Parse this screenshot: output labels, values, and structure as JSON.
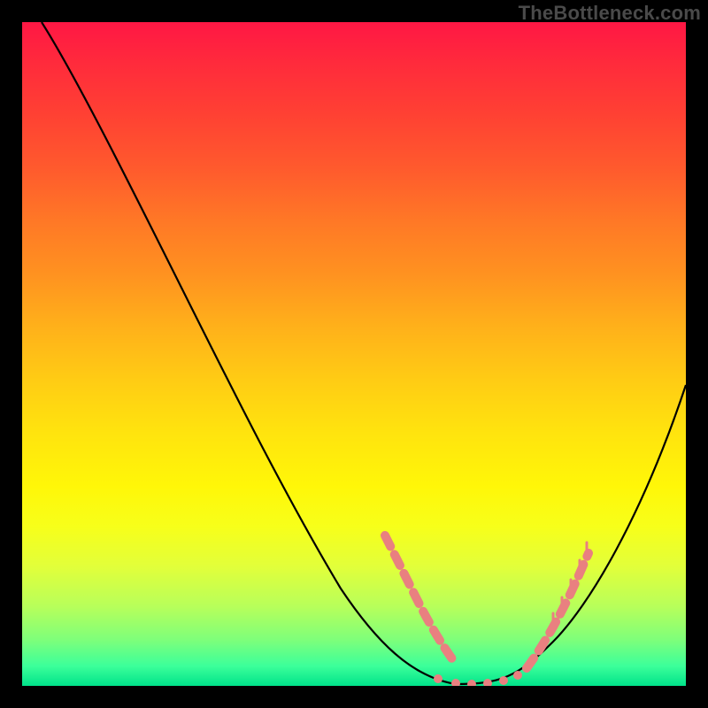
{
  "watermark": "TheBottleneck.com",
  "chart_data": {
    "type": "line",
    "title": "",
    "xlabel": "",
    "ylabel": "",
    "xlim": [
      0,
      100
    ],
    "ylim": [
      0,
      100
    ],
    "grid": false,
    "legend": false,
    "series": [
      {
        "name": "curve",
        "x": [
          3,
          8,
          13,
          18,
          23,
          28,
          33,
          38,
          43,
          48,
          53,
          58,
          63,
          68,
          73,
          78,
          83,
          88,
          93,
          98,
          100
        ],
        "y": [
          100,
          92,
          84,
          76,
          68,
          59,
          50,
          41,
          32,
          22,
          13,
          6,
          2,
          0,
          0,
          2,
          8,
          17,
          28,
          40,
          45
        ],
        "color": "#000000"
      }
    ],
    "highlight_region": {
      "name": "markers",
      "x_range": [
        55,
        82
      ],
      "color": "#e98080",
      "style": "dashed-dots"
    },
    "background_gradient": {
      "top": "#ff1744",
      "middle": "#ffe40e",
      "bottom": "#00e38a"
    }
  }
}
